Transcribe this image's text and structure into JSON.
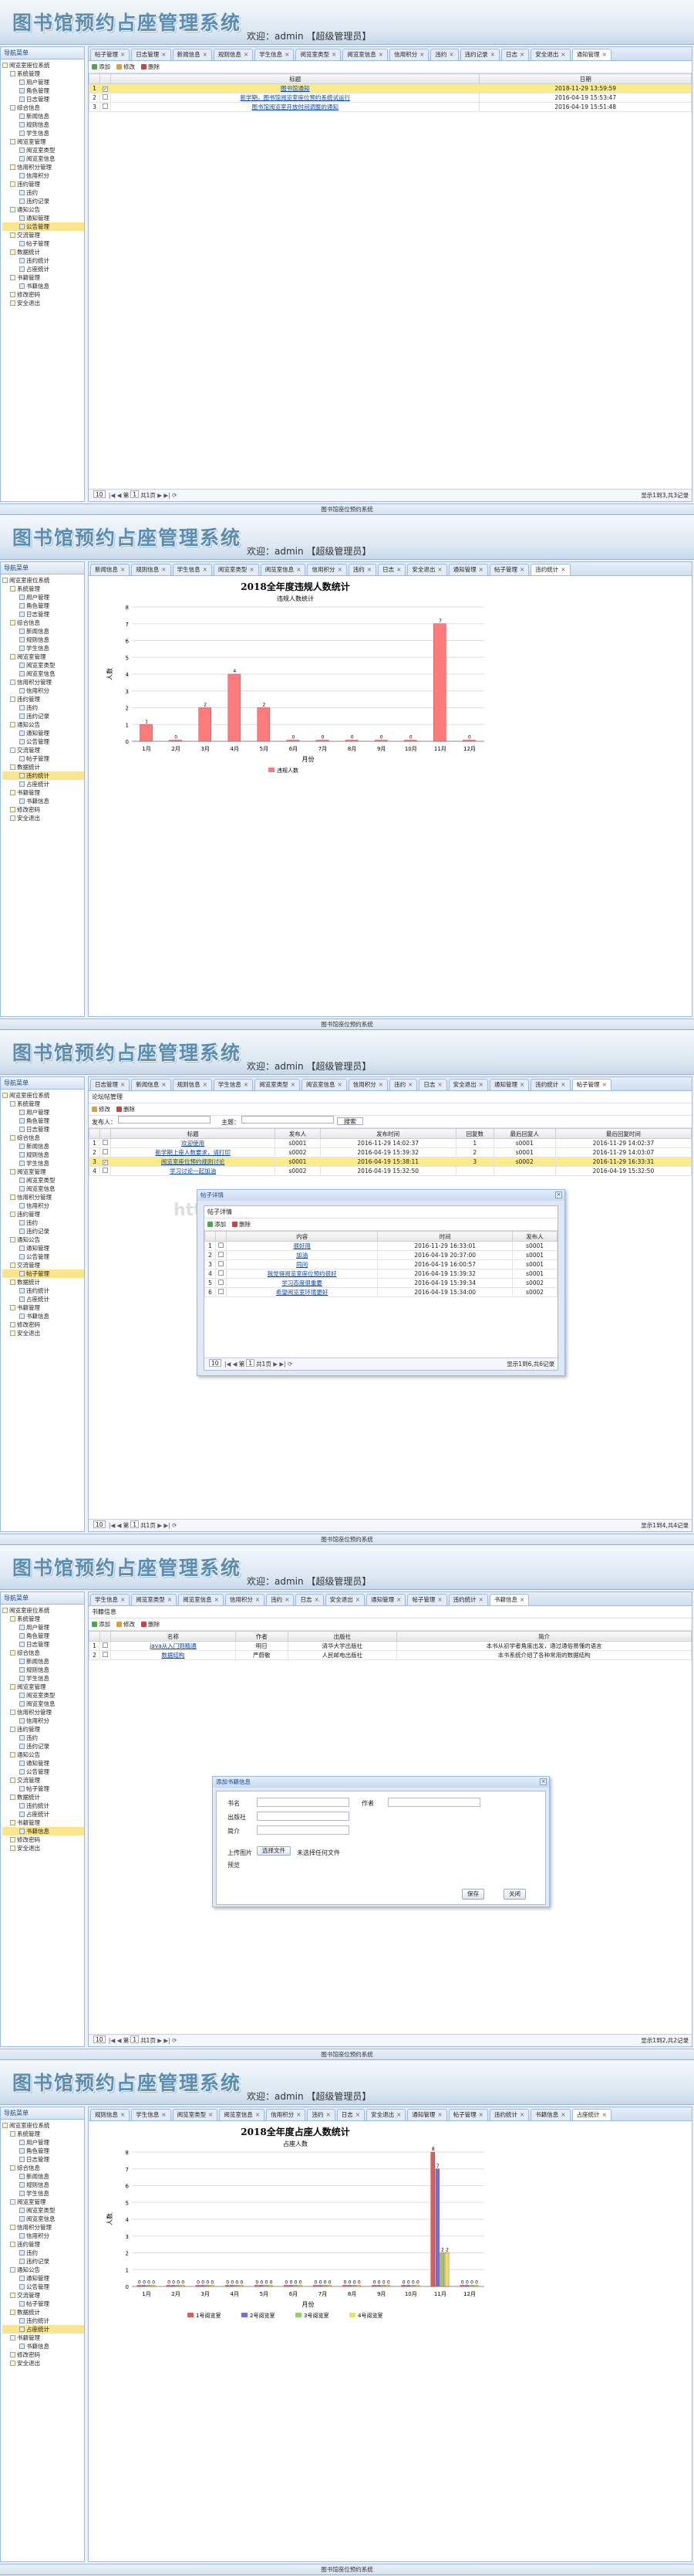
{
  "app": {
    "title": "图书馆预约占座管理系统",
    "welcome": "欢迎：admin 【超级管理员】",
    "footer": "图书馆座位预约系统",
    "sidebar_title": "导航菜单",
    "nav_root": "阅览室座位系统"
  },
  "screens": [
    {
      "sidebar": [
        "系统管理",
        "用户管理",
        "角色管理",
        "日志管理",
        "综合信息",
        "新闻信息",
        "规则信息",
        "学生信息",
        "阅览室管理",
        "阅览室类型",
        "阅览室信息",
        "信用积分管理",
        "信用积分",
        "违约管理",
        "违约",
        "违约记录",
        "通知公告",
        "通知管理",
        "公告管理",
        "交流管理",
        "帖子管理",
        "数据统计",
        "违约统计",
        "占座统计",
        "书籍管理",
        "书籍信息",
        "修改密码",
        "安全退出"
      ],
      "selected": 18,
      "tabs": [
        "帖子管理",
        "日志管理",
        "新闻信息",
        "规则信息",
        "学生信息",
        "阅览室类型",
        "阅览室信息",
        "信用积分",
        "违约",
        "违约记录",
        "日志",
        "安全退出",
        "通知管理"
      ],
      "active_tab": 12,
      "toolbar": [
        "添加",
        "修改",
        "删除"
      ],
      "columns": [
        "",
        "",
        "标题",
        "日期"
      ],
      "rows": [
        [
          "1",
          "图书馆通知",
          "2018-11-29 13:59:59"
        ],
        [
          "2",
          "新学期，图书馆阅览室座位预约系统试运行",
          "2016-04-19 15:53:47"
        ],
        [
          "3",
          "图书馆阅览室开放时间调整的通知",
          "2016-04-19 15:51:48"
        ]
      ],
      "highlight": 0,
      "pager": {
        "size": "10",
        "page": "1",
        "total": "共1页",
        "info": "显示1到3,共3记录"
      }
    },
    {
      "sidebar": [
        "系统管理",
        "用户管理",
        "角色管理",
        "日志管理",
        "综合信息",
        "新闻信息",
        "规则信息",
        "学生信息",
        "阅览室管理",
        "阅览室类型",
        "阅览室信息",
        "信用积分管理",
        "信用积分",
        "违约管理",
        "违约",
        "违约记录",
        "通知公告",
        "通知管理",
        "公告管理",
        "交流管理",
        "帖子管理",
        "数据统计",
        "违约统计",
        "占座统计",
        "书籍管理",
        "书籍信息",
        "修改密码",
        "安全退出"
      ],
      "selected": 22,
      "tabs": [
        "新闻信息",
        "规则信息",
        "学生信息",
        "阅览室类型",
        "阅览室信息",
        "信用积分",
        "违约",
        "日志",
        "安全退出",
        "通知管理",
        "帖子管理",
        "违约统计"
      ],
      "active_tab": 11
    },
    {
      "sidebar": [
        "系统管理",
        "用户管理",
        "角色管理",
        "日志管理",
        "综合信息",
        "新闻信息",
        "规则信息",
        "学生信息",
        "阅览室管理",
        "阅览室类型",
        "阅览室信息",
        "信用积分管理",
        "信用积分",
        "违约管理",
        "违约",
        "违约记录",
        "通知公告",
        "通知管理",
        "公告管理",
        "交流管理",
        "帖子管理",
        "数据统计",
        "违约统计",
        "占座统计",
        "书籍管理",
        "书籍信息",
        "修改密码",
        "安全退出"
      ],
      "selected": 20,
      "tabs": [
        "日志管理",
        "新闻信息",
        "规则信息",
        "学生信息",
        "阅览室类型",
        "阅览室信息",
        "信用积分",
        "违约",
        "日志",
        "安全退出",
        "通知管理",
        "违约统计",
        "帖子管理"
      ],
      "active_tab": 12,
      "panel_title": "论坛帖管理",
      "toolbar": [
        "修改",
        "删除"
      ],
      "search": {
        "publisher_label": "发布人：",
        "title_label": "主题：",
        "button": "搜索"
      },
      "columns": [
        "",
        "",
        "标题",
        "发布人",
        "发布时间",
        "回复数",
        "最后回复人",
        "最后回复时间"
      ],
      "rows": [
        [
          "1",
          "欢迎使用",
          "s0001",
          "2016-11-29 14:02:37",
          "1",
          "s0001",
          "2016-11-29 14:02:37"
        ],
        [
          "2",
          "新学期上座人数要求，请打印",
          "s0002",
          "2016-04-19 15:39:32",
          "2",
          "s0001",
          "2016-11-29 14:03:07"
        ],
        [
          "3",
          "阅览室座位预约规则讨论",
          "s0001",
          "2016-04-19 15:38:11",
          "3",
          "s0002",
          "2016-11-29 16:33:31"
        ],
        [
          "4",
          "学习讨论一起加油",
          "s0002",
          "2016-04-19 15:32:50",
          "",
          "",
          "2016-04-19 15:32:50"
        ]
      ],
      "highlight": 2,
      "dialog": {
        "title": "帖子详情",
        "sub": "帖子详情",
        "toolbar": [
          "添加",
          "删除"
        ],
        "columns": [
          "",
          "",
          "内容",
          "时间",
          "发布人"
        ],
        "rows": [
          [
            "1",
            "很好用",
            "2016-11-29 16:33:01",
            "s0001"
          ],
          [
            "2",
            "加油",
            "2016-04-19 20:37:00",
            "s0001"
          ],
          [
            "3",
            "同问",
            "2016-04-19 16:00:57",
            "s0001"
          ],
          [
            "4",
            "我觉得阅览室座位预约很好",
            "2016-04-19 15:39:32",
            "s0001"
          ],
          [
            "5",
            "学习态度很重要",
            "2016-04-19 15:39:34",
            "s0002"
          ],
          [
            "6",
            "希望阅览室环境更好",
            "2016-04-19 15:34:00",
            "s0002"
          ]
        ],
        "pager": {
          "size": "10",
          "page": "1",
          "total": "共1页",
          "info": "显示1到6,共6记录"
        }
      },
      "pager": {
        "size": "10",
        "page": "1",
        "total": "共1页",
        "info": "显示1到4,共4记录"
      },
      "watermark": "https://www.huzhan.com/ishop31216"
    },
    {
      "sidebar": [
        "系统管理",
        "用户管理",
        "角色管理",
        "日志管理",
        "综合信息",
        "新闻信息",
        "规则信息",
        "学生信息",
        "阅览室管理",
        "阅览室类型",
        "阅览室信息",
        "信用积分管理",
        "信用积分",
        "违约管理",
        "违约",
        "违约记录",
        "通知公告",
        "通知管理",
        "公告管理",
        "交流管理",
        "帖子管理",
        "数据统计",
        "违约统计",
        "占座统计",
        "书籍管理",
        "书籍信息",
        "修改密码",
        "安全退出"
      ],
      "selected": 25,
      "tabs": [
        "学生信息",
        "阅览室类型",
        "阅览室信息",
        "信用积分",
        "违约",
        "日志",
        "安全退出",
        "通知管理",
        "帖子管理",
        "违约统计",
        "书籍信息"
      ],
      "active_tab": 10,
      "panel_title": "书籍信息",
      "toolbar": [
        "添加",
        "修改",
        "删除"
      ],
      "columns": [
        "",
        "",
        "名称",
        "作者",
        "出版社",
        "简介"
      ],
      "rows": [
        [
          "1",
          "java从入门到精通",
          "明日",
          "清华大学出版社",
          "本书从初学者角度出发，通过通俗易懂的语言"
        ],
        [
          "2",
          "数据结构",
          "严蔚敏",
          "人民邮电出版社",
          "本书系统介绍了各种常用的数据结构"
        ]
      ],
      "form": {
        "title": "添加书籍信息",
        "name": "书名",
        "author": "作者",
        "publisher": "出版社",
        "intro": "简介",
        "upload": "上传图片",
        "choose": "选择文件",
        "nofile": "未选择任何文件",
        "preview": "预览",
        "save": "保存",
        "close": "关闭"
      },
      "pager": {
        "size": "10",
        "page": "1",
        "total": "共1页",
        "info": "显示1到2,共2记录"
      }
    },
    {
      "sidebar": [
        "系统管理",
        "用户管理",
        "角色管理",
        "日志管理",
        "综合信息",
        "新闻信息",
        "规则信息",
        "学生信息",
        "阅览室管理",
        "阅览室类型",
        "阅览室信息",
        "信用积分管理",
        "信用积分",
        "违约管理",
        "违约",
        "违约记录",
        "通知公告",
        "通知管理",
        "公告管理",
        "交流管理",
        "帖子管理",
        "数据统计",
        "违约统计",
        "占座统计",
        "书籍管理",
        "书籍信息",
        "修改密码",
        "安全退出"
      ],
      "selected": 23,
      "tabs": [
        "规则信息",
        "学生信息",
        "阅览室类型",
        "阅览室信息",
        "信用积分",
        "违约",
        "日志",
        "安全退出",
        "通知管理",
        "帖子管理",
        "违约统计",
        "书籍信息",
        "占座统计"
      ],
      "active_tab": 12
    }
  ],
  "chart_data": [
    {
      "type": "bar",
      "title": "2018全年度违规人数统计",
      "subtitle": "违规人数统计",
      "ylabel": "人数",
      "xlabel": "月份",
      "categories": [
        "1月",
        "2月",
        "3月",
        "4月",
        "5月",
        "6月",
        "7月",
        "8月",
        "9月",
        "10月",
        "11月",
        "12月"
      ],
      "series": [
        {
          "name": "违规人数",
          "values": [
            1,
            0,
            2,
            4,
            2,
            0,
            0,
            0,
            0,
            0,
            7,
            0
          ]
        }
      ],
      "ylim": [
        0,
        8
      ],
      "colors": [
        "#ff7b7b"
      ]
    },
    {
      "type": "bar",
      "title": "2018全年度占座人数统计",
      "subtitle": "占座人数",
      "ylabel": "人数",
      "xlabel": "月份",
      "categories": [
        "1月",
        "2月",
        "3月",
        "4月",
        "5月",
        "6月",
        "7月",
        "8月",
        "9月",
        "10月",
        "11月",
        "12月"
      ],
      "series": [
        {
          "name": "1号阅览室",
          "values": [
            0,
            0,
            0,
            0,
            0,
            0,
            0,
            0,
            0,
            0,
            8,
            0
          ]
        },
        {
          "name": "2号阅览室",
          "values": [
            0,
            0,
            0,
            0,
            0,
            0,
            0,
            0,
            0,
            0,
            7,
            0
          ]
        },
        {
          "name": "3号阅览室",
          "values": [
            0,
            0,
            0,
            0,
            0,
            0,
            0,
            0,
            0,
            0,
            2,
            0
          ]
        },
        {
          "name": "4号阅览室",
          "values": [
            0,
            0,
            0,
            0,
            0,
            0,
            0,
            0,
            0,
            0,
            2,
            0
          ]
        }
      ],
      "ylim": [
        0,
        8
      ],
      "colors": [
        "#e05b5b",
        "#6f6fe0",
        "#8fd06a",
        "#f0e060"
      ]
    }
  ]
}
